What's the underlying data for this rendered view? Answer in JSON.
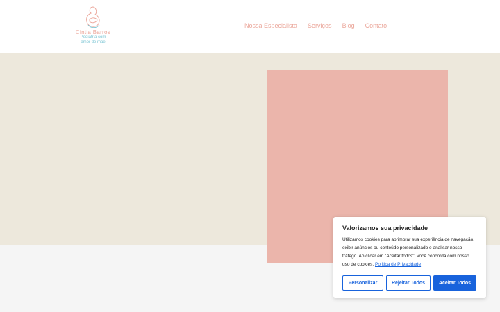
{
  "logo": {
    "name": "Cintia Barros",
    "tagline_1": "Pediatria com",
    "tagline_2": "amor de mãe"
  },
  "nav": {
    "items": [
      "Nossa Especialista",
      "Serviços",
      "Blog",
      "Contato"
    ]
  },
  "colors": {
    "brand_pink": "#eba79b",
    "brand_blue": "#79c4d3",
    "hero_bg": "#ede8dc",
    "hero_box": "#ebb5ab",
    "cookie_accent": "#1863dc"
  },
  "cookie": {
    "title": "Valorizamos sua privacidade",
    "body": "Utilizamos cookies para aprimorar sua experiência de navegação, exibir anúncios ou conteúdo personalizado e analisar nosso tráfego. Ao clicar em \"Aceitar todos\", você concorda com nosso uso de cookies.",
    "privacy_link": "Política de Privacidade",
    "customize_label": "Personalizar",
    "reject_label": "Rejeitar Todos",
    "accept_label": "Aceitar Todos"
  }
}
